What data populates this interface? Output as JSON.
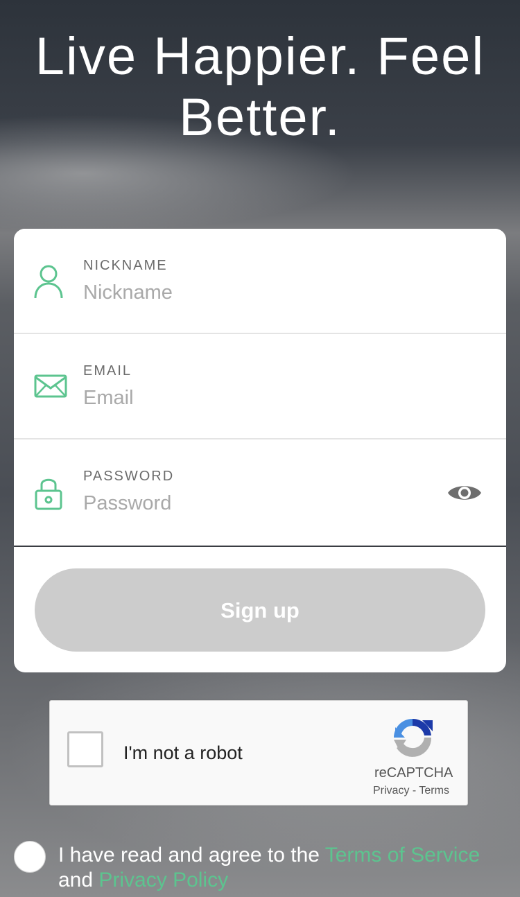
{
  "hero": {
    "line1": "Live Happier. Feel",
    "line2": "Better."
  },
  "form": {
    "nickname": {
      "label": "NICKNAME",
      "placeholder": "Nickname",
      "icon": "user-icon"
    },
    "email": {
      "label": "EMAIL",
      "placeholder": "Email",
      "icon": "envelope-icon"
    },
    "password": {
      "label": "PASSWORD",
      "placeholder": "Password",
      "icon": "lock-icon",
      "toggle_icon": "eye-icon"
    },
    "signup_label": "Sign up"
  },
  "recaptcha": {
    "label": "I'm not a robot",
    "brand": "reCAPTCHA",
    "privacy": "Privacy",
    "separator": "-",
    "terms": "Terms"
  },
  "agreement": {
    "prefix": "I have read and agree to the ",
    "terms_link": "Terms of Service",
    "middle": "and ",
    "privacy_link": "Privacy Policy"
  },
  "colors": {
    "accent": "#5cc48f",
    "button_disabled": "#cccccc",
    "card": "#ffffff"
  }
}
